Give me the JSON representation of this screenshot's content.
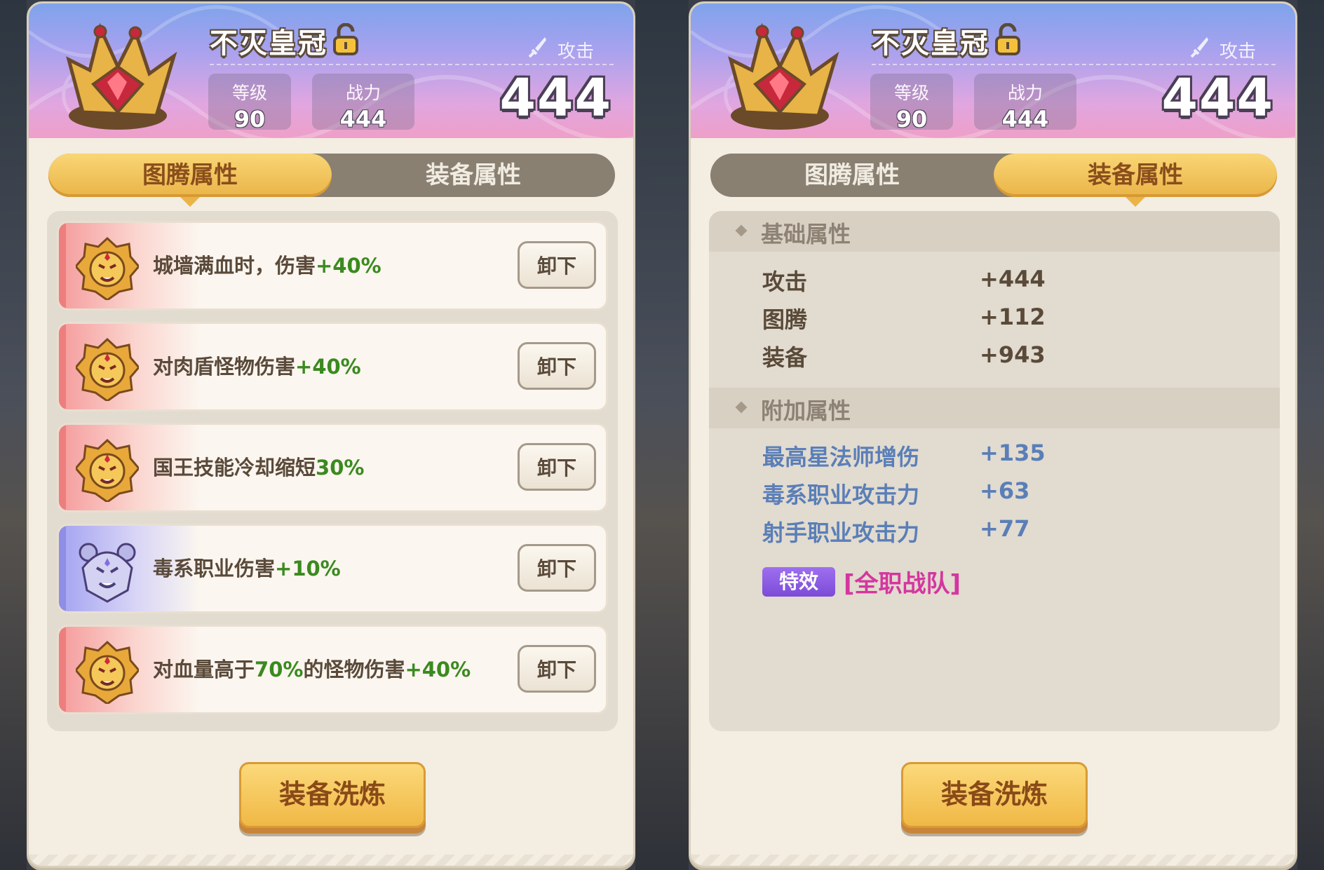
{
  "item": {
    "name": "不灭皇冠",
    "attack_label": "攻击",
    "level_label": "等级",
    "level_value": "90",
    "power_label": "战力",
    "power_value": "444",
    "attack_value": "444"
  },
  "tabs": {
    "totem": "图腾属性",
    "equip": "装备属性"
  },
  "totem_rows": [
    {
      "text": "城墙满血时，伤害",
      "value": "+40%",
      "button": "卸下",
      "tier": "red"
    },
    {
      "text": "对肉盾怪物伤害",
      "value": "+40%",
      "button": "卸下",
      "tier": "red"
    },
    {
      "text": "国王技能冷却缩短",
      "value": "30%",
      "button": "卸下",
      "tier": "red"
    },
    {
      "text": "毒系职业伤害",
      "value": "+10%",
      "button": "卸下",
      "tier": "blue"
    },
    {
      "text_a": "对血量高于",
      "value_mid": "70%",
      "text_b": "的怪物伤害",
      "value": "+40%",
      "button": "卸下",
      "tier": "red"
    }
  ],
  "refine_button": "装备洗炼",
  "equip_attrs": {
    "basic_title": "基础属性",
    "basic": [
      {
        "name": "攻击",
        "value": "+444"
      },
      {
        "name": "图腾",
        "value": "+112"
      },
      {
        "name": "装备",
        "value": "+943"
      }
    ],
    "extra_title": "附加属性",
    "extra": [
      {
        "name": "最高星法师增伤",
        "value": "+135"
      },
      {
        "name": "毒系职业攻击力",
        "value": "+63"
      },
      {
        "name": "射手职业攻击力",
        "value": "+77"
      }
    ],
    "special_badge": "特效",
    "special_effect": "[全职战队]"
  },
  "colors": {
    "gold_tab": "#eab448",
    "green_value": "#3a8a1f",
    "blue_attr": "#5a7fb8",
    "effect_pink": "#d436a0",
    "badge_purple": "#8a5ce4"
  }
}
